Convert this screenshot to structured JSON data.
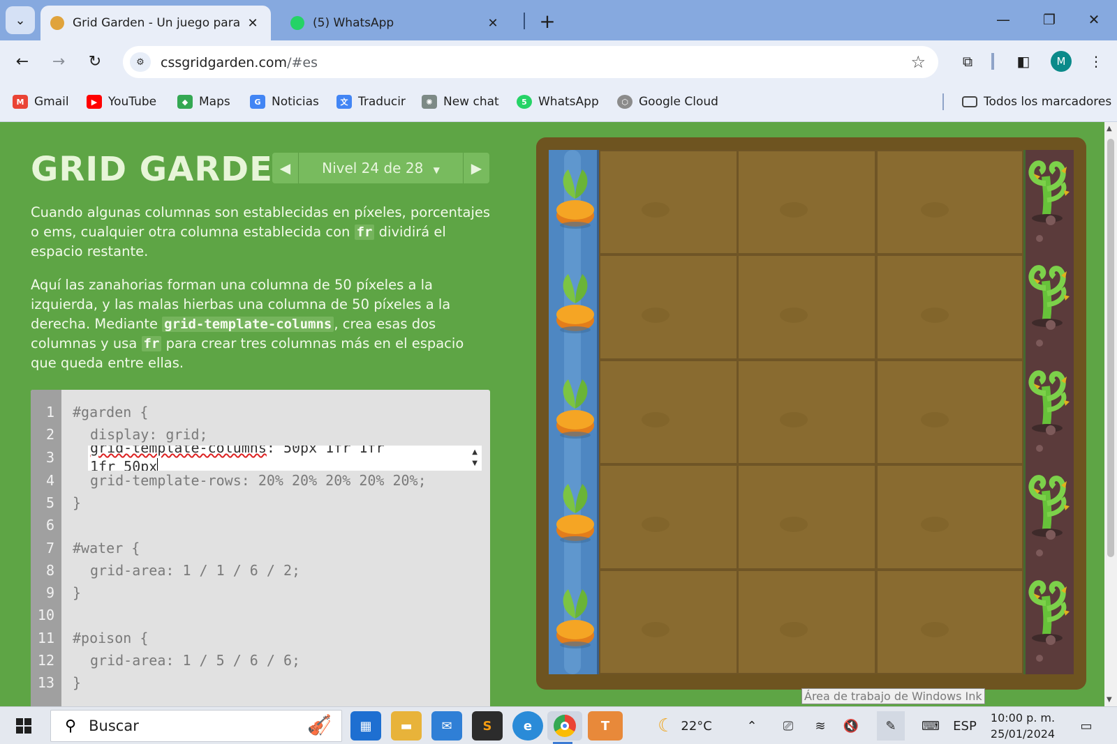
{
  "browser": {
    "tabs": [
      {
        "title": "Grid Garden - Un juego para ap",
        "active": true
      },
      {
        "title": "(5) WhatsApp",
        "active": false
      }
    ],
    "url_host": "cssgridgarden.com",
    "url_rest": "/#es",
    "profile_initial": "M",
    "bookmarks": [
      {
        "label": "Gmail",
        "icon": "gmail-icon",
        "color": "#ea4335"
      },
      {
        "label": "YouTube",
        "icon": "youtube-icon",
        "color": "#ff0000"
      },
      {
        "label": "Maps",
        "icon": "maps-icon",
        "color": "#34a853"
      },
      {
        "label": "Noticias",
        "icon": "news-icon",
        "color": "#4285f4"
      },
      {
        "label": "Traducir",
        "icon": "translate-icon",
        "color": "#4285f4"
      },
      {
        "label": "New chat",
        "icon": "chatgpt-icon",
        "color": "#444444"
      },
      {
        "label": "WhatsApp",
        "icon": "whatsapp-icon",
        "color": "#25d366"
      },
      {
        "label": "Google Cloud",
        "icon": "cloud-icon",
        "color": "#666666"
      }
    ],
    "all_bookmarks": "Todos los marcadores"
  },
  "game": {
    "logo": "GRID GARDEN",
    "level_label": "Nivel 24 de 28",
    "para1": {
      "a": "Cuando algunas columnas son establecidas en píxeles, porcentajes o ems, cualquier otra columna establecida con ",
      "code": "fr",
      "b": " dividirá el espacio restante."
    },
    "para2": {
      "a": "Aquí las zanahorias forman una columna de 50 píxeles a la izquierda, y las malas hierbas una columna de 50 píxeles a la derecha. Mediante ",
      "code1": "grid-template-columns",
      "b": ", crea esas dos columnas y usa ",
      "code2": "fr",
      "c": " para crear tres columnas más en el espacio que queda entre ellas."
    },
    "editor": {
      "line_numbers": [
        "1",
        "2",
        "3",
        "4",
        "5",
        "6",
        "7",
        "8",
        "9",
        "10",
        "11",
        "12",
        "13"
      ],
      "line1": "#garden {",
      "line2": "display: grid;",
      "input_line_a": "grid-template-columns",
      "input_line_b": ": 50px 1fr 1fr",
      "input_line_c": "1fr 50px",
      "line4": "grid-template-rows: 20% 20% 20% 20% 20%;",
      "line5": "}",
      "line7": "#water {",
      "line8": "grid-area: 1 / 1 / 6 / 2;",
      "line9": "}",
      "line11": "#poison {",
      "line12": "grid-area: 1 / 5 / 6 / 6;",
      "line13": "}"
    },
    "colors": {
      "background": "#5ea545",
      "water": "#4e87c2",
      "poison": "#5b3b3b",
      "soil": "#896b30"
    }
  },
  "ink_tooltip": "Área de trabajo de Windows Ink",
  "taskbar": {
    "search_placeholder": "Buscar",
    "weather": "22°C",
    "language": "ESP",
    "time": "10:00 p. m.",
    "date": "25/01/2024"
  }
}
